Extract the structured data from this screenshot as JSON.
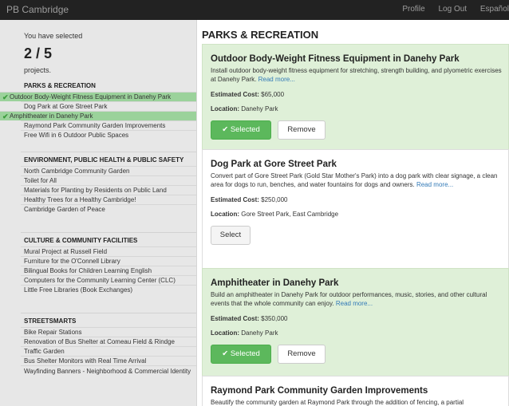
{
  "navbar": {
    "brand": "PB Cambridge",
    "profile": "Profile",
    "logout": "Log Out",
    "language": "Español"
  },
  "sidebar": {
    "selected_text": "You have selected",
    "count": "2 / 5",
    "projects_text": "projects.",
    "categories": [
      {
        "title": "PARKS & RECREATION",
        "items": [
          {
            "label": "Outdoor Body-Weight Fitness Equipment in Danehy Park",
            "selected": true
          },
          {
            "label": "Dog Park at Gore Street Park",
            "selected": false
          },
          {
            "label": "Amphitheater in Danehy Park",
            "selected": true
          },
          {
            "label": "Raymond Park Community Garden Improvements",
            "selected": false
          },
          {
            "label": "Free Wifi in 6 Outdoor Public Spaces",
            "selected": false
          }
        ]
      },
      {
        "title": "ENVIRONMENT, PUBLIC HEALTH & PUBLIC SAFETY",
        "items": [
          {
            "label": "North Cambridge Community Garden",
            "selected": false
          },
          {
            "label": "Toilet for All",
            "selected": false
          },
          {
            "label": "Materials for Planting by Residents on Public Land",
            "selected": false
          },
          {
            "label": "Healthy Trees for a Healthy Cambridge!",
            "selected": false
          },
          {
            "label": "Cambridge Garden of Peace",
            "selected": false
          }
        ]
      },
      {
        "title": "CULTURE & COMMUNITY FACILITIES",
        "items": [
          {
            "label": "Mural Project at Russell Field",
            "selected": false
          },
          {
            "label": "Furniture for the O'Connell Library",
            "selected": false
          },
          {
            "label": "Bilingual Books for Children Learning English",
            "selected": false
          },
          {
            "label": "Computers for the Community Learning Center (CLC)",
            "selected": false
          },
          {
            "label": "Little Free Libraries (Book Exchanges)",
            "selected": false
          }
        ]
      },
      {
        "title": "STREETSMARTS",
        "items": [
          {
            "label": "Bike Repair Stations",
            "selected": false
          },
          {
            "label": "Renovation of Bus Shelter at Comeau Field & Rindge",
            "selected": false
          },
          {
            "label": "Traffic Garden",
            "selected": false
          },
          {
            "label": "Bus Shelter Monitors with Real Time Arrival",
            "selected": false
          },
          {
            "label": "Wayfinding Banners - Neighborhood & Commercial Identity",
            "selected": false
          }
        ]
      }
    ]
  },
  "main": {
    "section_title": "PARKS & RECREATION",
    "labels": {
      "cost": "Estimated Cost:",
      "location": "Location:",
      "read_more": "Read more...",
      "selected": "Selected",
      "remove": "Remove",
      "select": "Select"
    },
    "cards": [
      {
        "title": "Outdoor Body-Weight Fitness Equipment in Danehy Park",
        "description": "Install outdoor body-weight fitness equipment for stretching, strength building, and plyometric exercises at Danehy Park.",
        "cost": "$65,000",
        "location": "Danehy Park",
        "selected": true
      },
      {
        "title": "Dog Park at Gore Street Park",
        "description": "Convert part of Gore Street Park (Gold Star Mother's Park) into a dog park with clear signage, a clean area for dogs to run, benches, and water fountains for dogs and owners.",
        "cost": "$250,000",
        "location": "Gore Street Park, East Cambridge",
        "selected": false
      },
      {
        "title": "Amphitheater in Danehy Park",
        "description": "Build an amphitheater in Danehy Park for outdoor performances, music, stories, and other cultural events that the whole community can enjoy.",
        "cost": "$350,000",
        "location": "Danehy Park",
        "selected": true
      },
      {
        "title": "Raymond Park Community Garden Improvements",
        "description": "Beautify the community garden at Raymond Park through the addition of fencing, a partial",
        "cost": "",
        "location": "",
        "selected": false
      }
    ]
  },
  "colors": {
    "navbar": "#222222",
    "sidebar": "#e7e7e7",
    "selected_row": "#9bd29b",
    "selected_card": "#dff0d8",
    "selected_button": "#5cb85c",
    "link": "#337ab7"
  }
}
